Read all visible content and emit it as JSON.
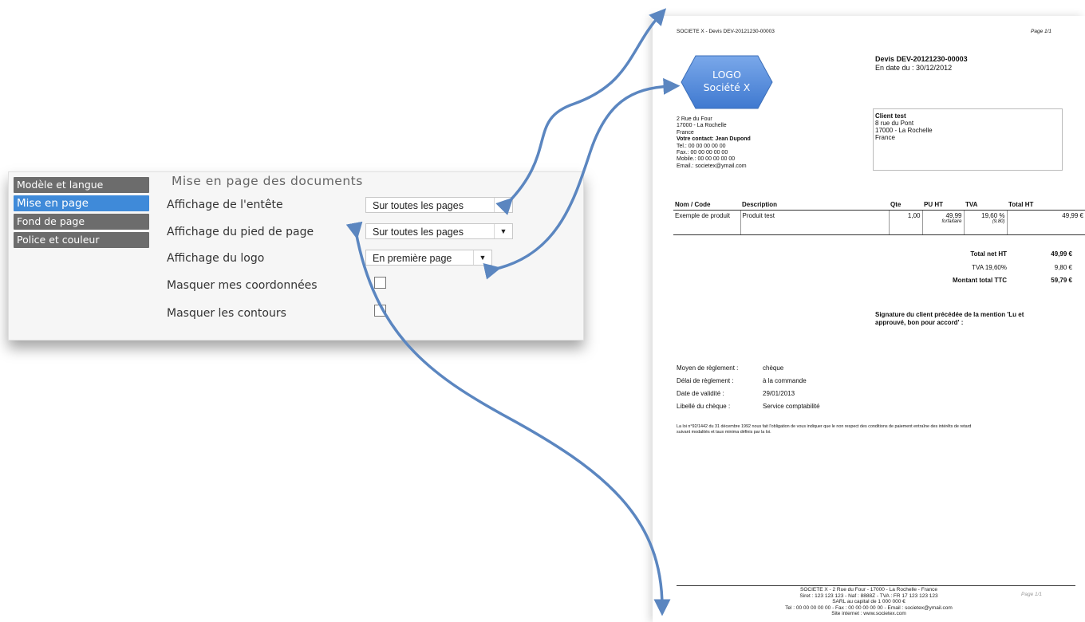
{
  "panel": {
    "title": "Mise en page des documents",
    "nav": [
      "Modèle et langue",
      "Mise en page",
      "Fond de page",
      "Police et couleur"
    ],
    "rows": {
      "header_label": "Affichage de l'entête",
      "header_value": "Sur toutes les pages",
      "footer_label": "Affichage du pied de page",
      "footer_value": "Sur toutes les pages",
      "logo_label": "Affichage du logo",
      "logo_value": "En première page",
      "hide_coords_label": "Masquer mes coordonnées",
      "hide_borders_label": "Masquer les contours"
    },
    "accent": "#3f8ad9"
  },
  "doc": {
    "header_left": "SOCIETE X - Devis DEV-20121230-00003",
    "header_right": "Page 1/1",
    "logo_line1": "LOGO",
    "logo_line2": "Société X",
    "devis_title": "Devis DEV-20121230-00003",
    "devis_date": "En date du : 30/12/2012",
    "company": [
      "2 Rue du Four",
      "17000 - La Rochelle",
      "France"
    ],
    "contact": "Votre contact: Jean Dupond",
    "company_contact": [
      "Tel.: 00 00 00 00 00",
      "Fax.: 00 00 00 00 00",
      "Mobile.: 00 00 00 00 00",
      "Email.: societex@ymail.com"
    ],
    "client_name": "Client test",
    "client_address": [
      "8 rue du Pont",
      "17000 - La Rochelle",
      "France"
    ],
    "table_headers": [
      "Nom / Code",
      "Description",
      "Qte",
      "PU HT",
      "TVA",
      "Total HT"
    ],
    "row": {
      "name": "Exemple de produit",
      "description": "Produit test",
      "qte": "1,00",
      "pu": "49,99",
      "pu_note": "forfaitaire",
      "tva": "19,60 %",
      "tva_note": "(9,80)",
      "total": "49,99 €"
    },
    "totals": [
      {
        "label": "Total net HT",
        "value": "49,99 €"
      },
      {
        "label": "TVA 19,60%",
        "value": "9,80 €"
      },
      {
        "label": "Montant total TTC",
        "value": "59,79 €"
      }
    ],
    "signature_line1": "Signature du client précédée de la mention 'Lu et",
    "signature_line2": "approuvé, bon pour accord' :",
    "payment": [
      {
        "label": "Moyen de règlement :",
        "value": "chèque"
      },
      {
        "label": "Délai de règlement :",
        "value": "à la commande"
      },
      {
        "label": "Date de validité :",
        "value": "29/01/2013"
      },
      {
        "label": "Libellé du chèque :",
        "value": "Service comptabilité"
      }
    ],
    "law_line1": "La loi n°92/1442 du 31 décembre 1992 nous fait l'obligation de vous indiquer que le non respect des conditions de paiement entraîne des intérêts de retard",
    "law_line2": "suivant modalités et taux minima définis par la loi.",
    "footer": [
      "SOCIETE X - 2 Rue du Four - 17000 - La Rochelle - France",
      "Siret : 123 123 123 - Naf : 8888Z - TVA : FR 17 123 123 123",
      "SARL au capital de 1 000 000 €",
      "Tel : 00 00 00 00 00 - Fax : 00 00 00 00 00 - Email : societex@ymail.com",
      "Site internet : www.societex.com"
    ],
    "footer_page": "Page 1/1"
  },
  "colors": {
    "arrow": "#5b86c0",
    "logo_hex": "#4f86d9"
  }
}
